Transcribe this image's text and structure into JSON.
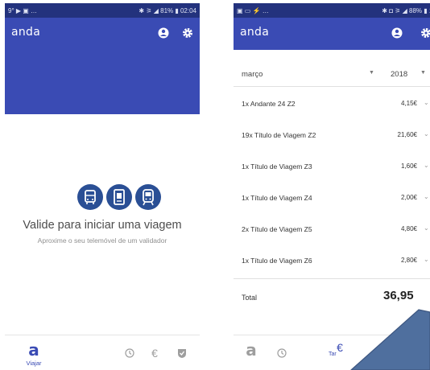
{
  "left_screen": {
    "status_bar": {
      "left": "9° ▶ ▣ …",
      "right": "✱ ⚞ ◢ 81% ▮ 02:04"
    },
    "app_bar": {
      "logo": "anda",
      "account_icon": "account-icon",
      "settings_icon": "gear-icon"
    },
    "validate": {
      "icons": [
        "bus-icon",
        "card-reader-icon",
        "train-icon"
      ],
      "title": "Valide para iniciar uma viagem",
      "subtitle": "Aproxime o seu telemóvel de um validador"
    },
    "bottom_nav": {
      "travel": {
        "glyph": "a",
        "label": "Viajar"
      },
      "history_icon": "history-icon",
      "euro_icon": "euro-icon",
      "shield_icon": "shield-check-icon"
    }
  },
  "right_screen": {
    "status_bar": {
      "left": "▣ ▭ ⚡ …",
      "right": "✱ ◘ ⚞ ◢ 88% ▮ 13:"
    },
    "app_bar": {
      "logo": "anda",
      "account_icon": "account-icon",
      "settings_icon": "gear-icon"
    },
    "filter": {
      "month": "março",
      "year": "2018"
    },
    "charges": [
      {
        "description": "1x Andante 24 Z2",
        "amount": "4,15€"
      },
      {
        "description": "19x Título de Viagem Z2",
        "amount": "21,60€"
      },
      {
        "description": "1x Título de Viagem Z3",
        "amount": "1,60€"
      },
      {
        "description": "1x Título de Viagem Z4",
        "amount": "2,00€"
      },
      {
        "description": "2x Título de Viagem Z5",
        "amount": "4,80€"
      },
      {
        "description": "1x Título de Viagem Z6",
        "amount": "2,80€"
      }
    ],
    "total": {
      "label": "Total",
      "value": "36,95"
    },
    "bottom_nav": {
      "travel_glyph": "a",
      "euro_glyph": "€",
      "active_label": "Tar"
    }
  },
  "colors": {
    "primary": "#3a4bb4",
    "status": "#23327d",
    "icon_blue": "#2a4f95",
    "arrow": "#4f6f9e"
  }
}
